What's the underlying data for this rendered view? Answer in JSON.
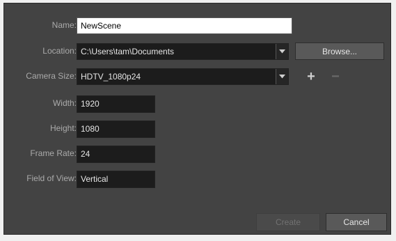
{
  "form": {
    "name": {
      "label": "Name:",
      "value": "NewScene"
    },
    "location": {
      "label": "Location:",
      "value": "C:\\Users\\tam\\Documents"
    },
    "browse_label": "Browse...",
    "camera_size": {
      "label": "Camera Size:",
      "value": "HDTV_1080p24"
    },
    "width": {
      "label": "Width:",
      "value": "1920"
    },
    "height": {
      "label": "Height:",
      "value": "1080"
    },
    "frame_rate": {
      "label": "Frame Rate:",
      "value": "24"
    },
    "field_of_view": {
      "label": "Field of View:",
      "value": "Vertical"
    }
  },
  "icons": {
    "add": "+",
    "remove": "−"
  },
  "footer": {
    "create_label": "Create",
    "cancel_label": "Cancel"
  },
  "colors": {
    "dialog_bg": "#434343",
    "field_bg": "#1c1c1c",
    "button_bg": "#595959",
    "label_text": "#aaaaaa"
  }
}
